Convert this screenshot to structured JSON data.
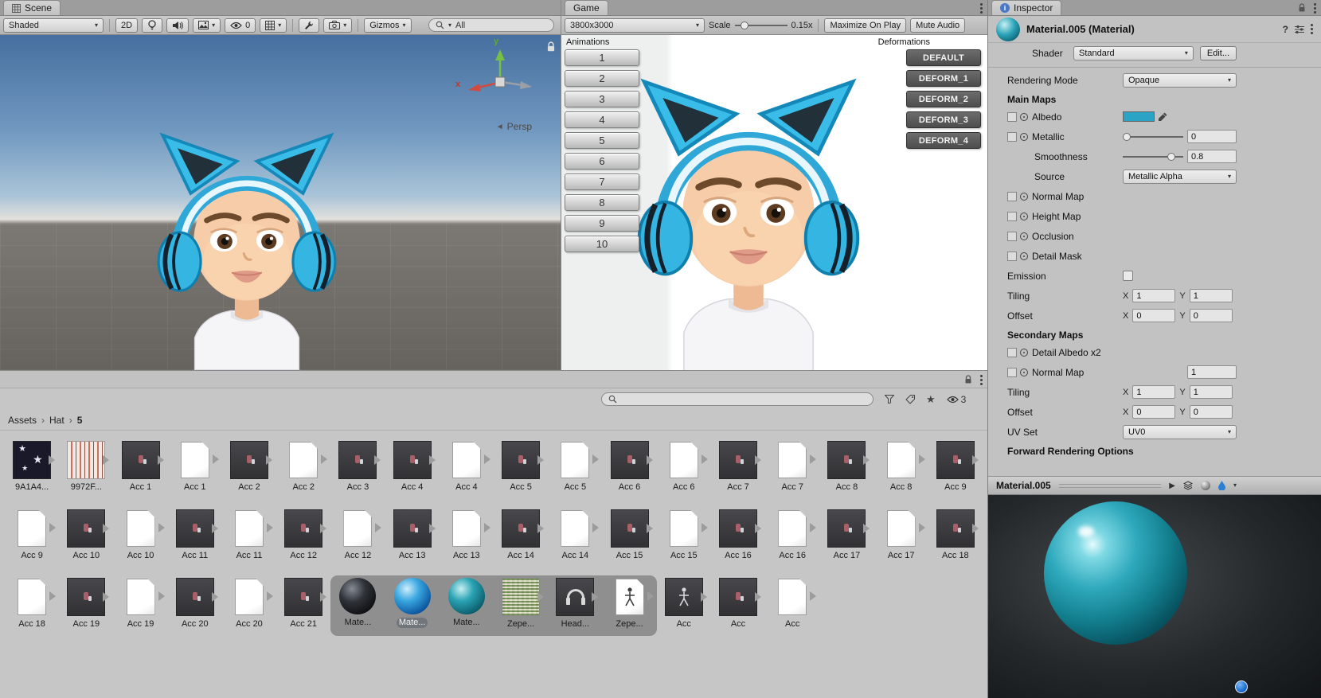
{
  "colors": {
    "accent_teal": "#2BA3C4",
    "headphone_blue": "#35B5E2",
    "preview_bg": "#24282B"
  },
  "icons": {
    "search": "magnifier",
    "visibility": "eye",
    "lock": "padlock",
    "more": "kebab-dots",
    "expand": "right-arrow"
  },
  "scene": {
    "tab": "Scene",
    "toolbar": {
      "draw_mode": "Shaded",
      "btn_2d": "2D",
      "visibility_count": "0",
      "gizmos_label": "Gizmos",
      "search_value": "All"
    },
    "gizmo": {
      "axis_x": "x",
      "axis_y": "y",
      "persp_label": "Persp"
    }
  },
  "game": {
    "tab": "Game",
    "toolbar": {
      "resolution": "3800x3000",
      "scale_label": "Scale",
      "scale_value": "0.15x",
      "maximize_label": "Maximize On Play",
      "mute_label": "Mute Audio"
    },
    "animations": {
      "label": "Animations",
      "buttons": [
        "1",
        "2",
        "3",
        "4",
        "5",
        "6",
        "7",
        "8",
        "9",
        "10"
      ]
    },
    "deformations": {
      "label": "Deformations",
      "buttons": [
        "DEFAULT",
        "DEFORM_1",
        "DEFORM_2",
        "DEFORM_3",
        "DEFORM_4"
      ]
    }
  },
  "inspector": {
    "tab": "Inspector",
    "header": {
      "title": "Material.005 (Material)"
    },
    "shader": {
      "label": "Shader",
      "value": "Standard",
      "edit_button": "Edit..."
    },
    "rendering_mode": {
      "label": "Rendering Mode",
      "value": "Opaque"
    },
    "main_maps": {
      "header": "Main Maps",
      "albedo_label": "Albedo",
      "metallic_label": "Metallic",
      "metallic_value": "0",
      "smoothness_label": "Smoothness",
      "smoothness_value": "0.8",
      "source_label": "Source",
      "source_value": "Metallic Alpha",
      "texture_rows": [
        "Normal Map",
        "Height Map",
        "Occlusion",
        "Detail Mask"
      ],
      "emission_label": "Emission",
      "tiling": {
        "label": "Tiling",
        "x_label": "X",
        "x": "1",
        "y_label": "Y",
        "y": "1"
      },
      "offset": {
        "label": "Offset",
        "x_label": "X",
        "x": "0",
        "y_label": "Y",
        "y": "0"
      }
    },
    "secondary_maps": {
      "header": "Secondary Maps",
      "detail_albedo_label": "Detail Albedo x2",
      "normal_map_label": "Normal Map",
      "normal_map_value": "1",
      "tiling": {
        "label": "Tiling",
        "x_label": "X",
        "x": "1",
        "y_label": "Y",
        "y": "1"
      },
      "offset": {
        "label": "Offset",
        "x_label": "X",
        "x": "0",
        "y_label": "Y",
        "y": "0"
      },
      "uv_set_label": "UV Set",
      "uv_set_value": "UV0"
    },
    "forward_rendering_header": "Forward Rendering Options",
    "preview": {
      "title": "Material.005"
    }
  },
  "project": {
    "breadcrumb": [
      "Assets",
      "Hat",
      "5"
    ],
    "visibility_count": "3",
    "asset_rows": [
      [
        {
          "label": "9A1A4...",
          "icon": "texture-stars"
        },
        {
          "label": "9972F...",
          "icon": "texture-stripes"
        },
        {
          "label": "Acc 1",
          "icon": "prefab"
        },
        {
          "label": "Acc 1",
          "icon": "doc"
        },
        {
          "label": "Acc 2",
          "icon": "prefab"
        },
        {
          "label": "Acc 2",
          "icon": "doc"
        },
        {
          "label": "Acc 3",
          "icon": "prefab"
        },
        {
          "label": "Acc 4",
          "icon": "prefab"
        },
        {
          "label": "Acc 4",
          "icon": "doc"
        },
        {
          "label": "Acc 5",
          "icon": "prefab"
        },
        {
          "label": "Acc 5",
          "icon": "doc"
        },
        {
          "label": "Acc 6",
          "icon": "prefab"
        },
        {
          "label": "Acc 6",
          "icon": "doc"
        },
        {
          "label": "Acc 7",
          "icon": "prefab"
        },
        {
          "label": "Acc 7",
          "icon": "doc"
        },
        {
          "label": "Acc 8",
          "icon": "prefab"
        },
        {
          "label": "Acc 8",
          "icon": "doc"
        },
        {
          "label": "Acc 9",
          "icon": "prefab"
        }
      ],
      [
        {
          "label": "Acc 9",
          "icon": "doc"
        },
        {
          "label": "Acc 10",
          "icon": "prefab"
        },
        {
          "label": "Acc 10",
          "icon": "doc"
        },
        {
          "label": "Acc 11",
          "icon": "prefab"
        },
        {
          "label": "Acc 11",
          "icon": "doc"
        },
        {
          "label": "Acc 12",
          "icon": "prefab"
        },
        {
          "label": "Acc 12",
          "icon": "doc"
        },
        {
          "label": "Acc 13",
          "icon": "prefab"
        },
        {
          "label": "Acc 13",
          "icon": "doc"
        },
        {
          "label": "Acc 14",
          "icon": "prefab"
        },
        {
          "label": "Acc 14",
          "icon": "doc"
        },
        {
          "label": "Acc 15",
          "icon": "prefab"
        },
        {
          "label": "Acc 15",
          "icon": "doc"
        },
        {
          "label": "Acc 16",
          "icon": "prefab"
        },
        {
          "label": "Acc 16",
          "icon": "doc"
        },
        {
          "label": "Acc 17",
          "icon": "prefab"
        },
        {
          "label": "Acc 17",
          "icon": "doc"
        },
        {
          "label": "Acc 18",
          "icon": "prefab"
        }
      ],
      [
        {
          "label": "Acc 18",
          "icon": "doc"
        },
        {
          "label": "Acc 19",
          "icon": "prefab"
        },
        {
          "label": "Acc 19",
          "icon": "doc"
        },
        {
          "label": "Acc 20",
          "icon": "prefab"
        },
        {
          "label": "Acc 20",
          "icon": "doc"
        },
        {
          "label": "Acc 21",
          "icon": "prefab"
        },
        {
          "label": "Mate...",
          "icon": "sphere-dark",
          "band": true
        },
        {
          "label": "Mate...",
          "icon": "sphere-blue",
          "band": true,
          "focus": true
        },
        {
          "label": "Mate...",
          "icon": "sphere-teal",
          "band": true
        },
        {
          "label": "Zepe...",
          "icon": "texture-noise",
          "band": true
        },
        {
          "label": "Head...",
          "icon": "prefab-head",
          "band": true
        },
        {
          "label": "Zepe...",
          "icon": "doc-figure",
          "band": true
        },
        {
          "label": "Acc",
          "icon": "prefab-figure"
        },
        {
          "label": "Acc",
          "icon": "prefab"
        },
        {
          "label": "Acc",
          "icon": "doc"
        }
      ]
    ]
  }
}
